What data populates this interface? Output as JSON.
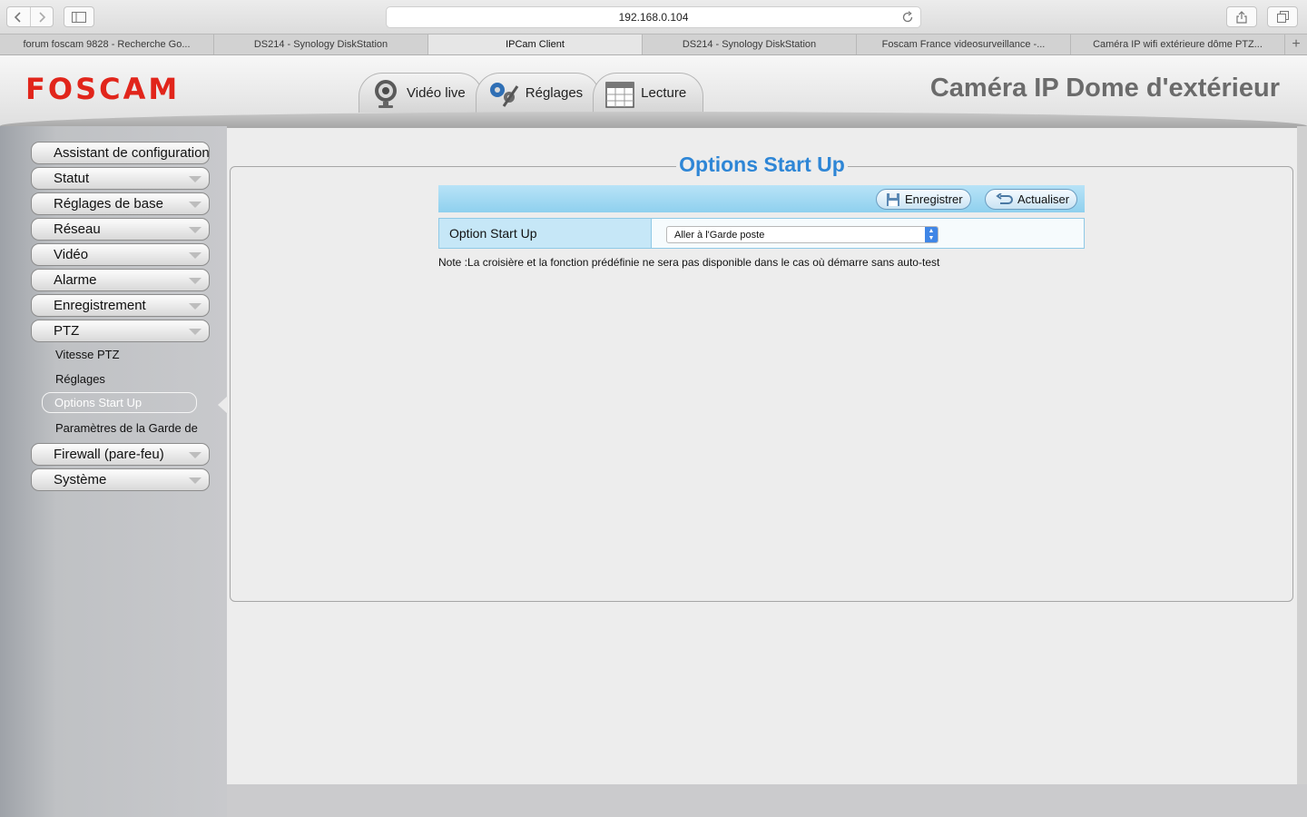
{
  "browser": {
    "url": "192.168.0.104",
    "tabs": [
      {
        "label": "forum foscam 9828 - Recherche Go..."
      },
      {
        "label": "DS214 - Synology DiskStation"
      },
      {
        "label": "IPCam Client"
      },
      {
        "label": "DS214 - Synology DiskStation"
      },
      {
        "label": "Foscam France videosurveillance -..."
      },
      {
        "label": "Caméra IP wifi extérieure dôme PTZ..."
      }
    ],
    "active_tab": 2,
    "new_tab_symbol": "+"
  },
  "header": {
    "logo": "FOSCAM",
    "product_title": "Caméra IP Dome d'extérieur",
    "tabs": [
      {
        "label": "Vidéo live",
        "icon": "webcam-icon"
      },
      {
        "label": "Réglages",
        "icon": "gears-icon"
      },
      {
        "label": "Lecture",
        "icon": "calendar-icon"
      }
    ]
  },
  "sidebar": {
    "menus": [
      {
        "label": "Assistant de configuration"
      },
      {
        "label": "Statut"
      },
      {
        "label": "Réglages de base"
      },
      {
        "label": "Réseau"
      },
      {
        "label": "Vidéo"
      },
      {
        "label": "Alarme"
      },
      {
        "label": "Enregistrement"
      },
      {
        "label": "PTZ"
      }
    ],
    "ptz_submenu": [
      {
        "label": "Vitesse PTZ"
      },
      {
        "label": "Réglages"
      },
      {
        "label": "Options Start Up"
      },
      {
        "label": "Paramètres de la Garde de"
      }
    ],
    "menus_after": [
      {
        "label": "Firewall (pare-feu)"
      },
      {
        "label": "Système"
      }
    ]
  },
  "content": {
    "title": "Options Start Up",
    "save_label": "Enregistrer",
    "refresh_label": "Actualiser",
    "field_label": "Option Start Up",
    "field_value": "Aller à l'Garde poste",
    "note": "Note :La croisière et la fonction prédéfinie ne sera pas disponible dans le cas où démarre sans auto-test"
  },
  "colors": {
    "accent": "#2e86d6",
    "logo": "#e1251b",
    "action_bar": "#9fd7f0"
  }
}
